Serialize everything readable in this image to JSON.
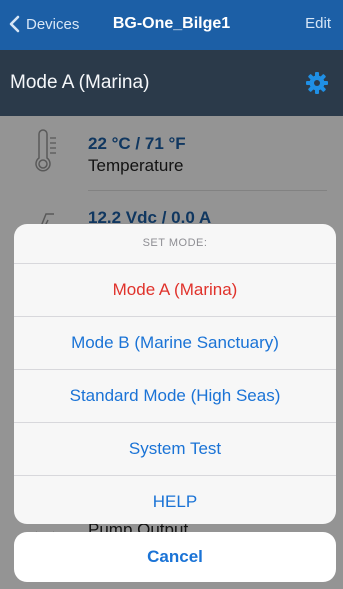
{
  "nav": {
    "back_label": "Devices",
    "title": "BG-One_Bilge1",
    "edit_label": "Edit"
  },
  "mode_bar": {
    "title": "Mode A (Marina)"
  },
  "readings": [
    {
      "value": "22 °C / 71 °F",
      "label": "Temperature",
      "icon": "thermometer-icon"
    },
    {
      "value": "12.2 Vdc / 0.0 A",
      "label": "",
      "icon": "voltage-icon"
    },
    {
      "value": "",
      "label": "Pump Output",
      "icon": "pump-icon"
    }
  ],
  "sheet": {
    "title": "SET MODE:",
    "options": [
      "Mode A (Marina)",
      "Mode B (Marine Sanctuary)",
      "Standard Mode (High Seas)",
      "System Test",
      "HELP"
    ],
    "selected_index": 0,
    "cancel_label": "Cancel"
  },
  "colors": {
    "nav_bg": "#1c5fa6",
    "mode_bar_bg": "#2b3a4a",
    "accent": "#1a73d6",
    "selected": "#e0322b"
  }
}
